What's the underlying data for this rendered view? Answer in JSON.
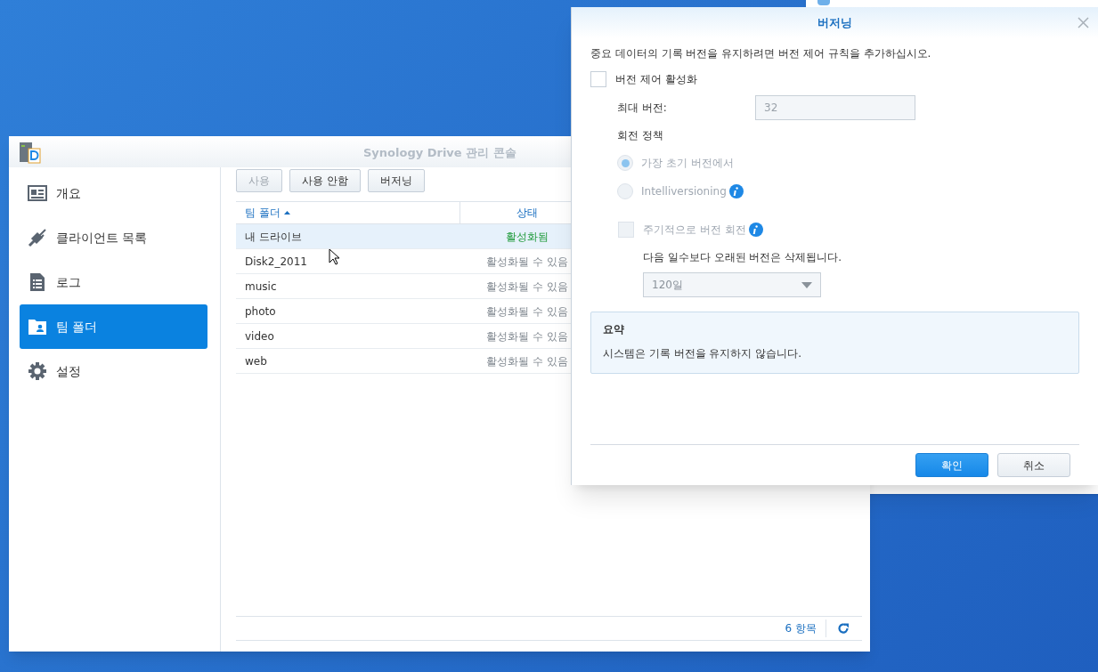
{
  "main_window": {
    "title": "Synology Drive 관리 콘솔",
    "sidebar": {
      "items": [
        {
          "label": "개요",
          "selected": false
        },
        {
          "label": "클라이언트 목록",
          "selected": false
        },
        {
          "label": "로그",
          "selected": false
        },
        {
          "label": "팀 폴더",
          "selected": true
        },
        {
          "label": "설정",
          "selected": false
        }
      ]
    },
    "toolbar": {
      "buttons": [
        {
          "label": "사용",
          "disabled": true
        },
        {
          "label": "사용 안함",
          "disabled": false
        },
        {
          "label": "버저닝",
          "disabled": false
        }
      ]
    },
    "table": {
      "columns": [
        {
          "label": "팀 폴더",
          "sorted": true
        },
        {
          "label": "상태",
          "sorted": false
        }
      ],
      "rows": [
        {
          "name": "내 드라이브",
          "status": "활성화됨",
          "enabled": true,
          "selected": true
        },
        {
          "name": "Disk2_2011",
          "status": "활성화될 수 있음",
          "enabled": false,
          "selected": false
        },
        {
          "name": "music",
          "status": "활성화될 수 있음",
          "enabled": false,
          "selected": false
        },
        {
          "name": "photo",
          "status": "활성화될 수 있음",
          "enabled": false,
          "selected": false
        },
        {
          "name": "video",
          "status": "활성화될 수 있음",
          "enabled": false,
          "selected": false
        },
        {
          "name": "web",
          "status": "활성화될 수 있음",
          "enabled": false,
          "selected": false
        }
      ]
    },
    "footer": {
      "count": "6 항목"
    }
  },
  "dialog": {
    "title": "버저닝",
    "description": "중요 데이터의 기록 버전을 유지하려면 버전 제어 규칙을 추가하십시오.",
    "enable_checkbox": {
      "label": "버전 제어 활성화",
      "checked": false
    },
    "max_versions": {
      "label": "최대 버전:",
      "value": "32",
      "disabled": true
    },
    "rotation_policy": {
      "label": "회전 정책",
      "options": [
        {
          "label": "가장 초기 버전에서",
          "selected": true,
          "disabled": true,
          "info": false
        },
        {
          "label": "Intelliversioning",
          "selected": false,
          "disabled": true,
          "info": true
        }
      ]
    },
    "periodic_rotation": {
      "label": "주기적으로 버전 회전",
      "checked": false,
      "disabled": true,
      "info": true
    },
    "retention_note": "다음 일수보다 오래된 버전은 삭제됩니다.",
    "retention_select": {
      "value": "120일",
      "disabled": true
    },
    "summary": {
      "title": "요약",
      "text": "시스템은 기록 버전을 유지하지 않습니다."
    },
    "buttons": [
      {
        "label": "확인",
        "kind": "primary"
      },
      {
        "label": "취소",
        "kind": "secondary"
      }
    ]
  }
}
